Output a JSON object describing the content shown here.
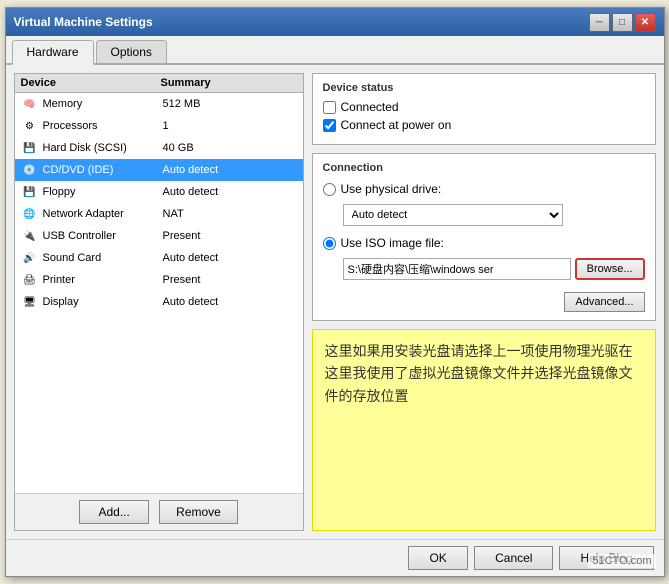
{
  "window": {
    "title": "Virtual Machine Settings",
    "close_btn": "✕",
    "minimize_btn": "─",
    "maximize_btn": "□"
  },
  "tabs": [
    {
      "label": "Hardware",
      "active": true
    },
    {
      "label": "Options",
      "active": false
    }
  ],
  "device_table": {
    "col_device": "Device",
    "col_summary": "Summary",
    "rows": [
      {
        "icon": "🧠",
        "name": "Memory",
        "summary": "512 MB"
      },
      {
        "icon": "⚙️",
        "name": "Processors",
        "summary": "1"
      },
      {
        "icon": "💾",
        "name": "Hard Disk (SCSI)",
        "summary": "40 GB"
      },
      {
        "icon": "💿",
        "name": "CD/DVD (IDE)",
        "summary": "Auto detect",
        "selected": true
      },
      {
        "icon": "💾",
        "name": "Floppy",
        "summary": "Auto detect"
      },
      {
        "icon": "🌐",
        "name": "Network Adapter",
        "summary": "NAT"
      },
      {
        "icon": "🔌",
        "name": "USB Controller",
        "summary": "Present"
      },
      {
        "icon": "🔊",
        "name": "Sound Card",
        "summary": "Auto detect"
      },
      {
        "icon": "🖨️",
        "name": "Printer",
        "summary": "Present"
      },
      {
        "icon": "🖥️",
        "name": "Display",
        "summary": "Auto detect"
      }
    ]
  },
  "bottom_buttons": {
    "add": "Add...",
    "remove": "Remove"
  },
  "device_status": {
    "title": "Device status",
    "connected_label": "Connected",
    "connected_checked": false,
    "connect_power_label": "Connect at power on",
    "connect_power_checked": true
  },
  "connection": {
    "title": "Connection",
    "physical_label": "Use physical drive:",
    "physical_selected": false,
    "auto_detect_option": "Auto detect",
    "iso_label": "Use ISO image file:",
    "iso_selected": true,
    "iso_value": "S:\\硬盘内容\\压缩\\windows ser",
    "browse_label": "Browse...",
    "advanced_label": "Advanced..."
  },
  "annotation": {
    "text": "这里如果用安装光盘请选择上一项使用物理光驱在这里我使用了虚拟光盘镜像文件并选择光盘镜像文件的存放位置"
  },
  "footer": {
    "ok": "OK",
    "cancel": "Cancel",
    "help": "Help Blog"
  },
  "watermark": "51CTO.com"
}
